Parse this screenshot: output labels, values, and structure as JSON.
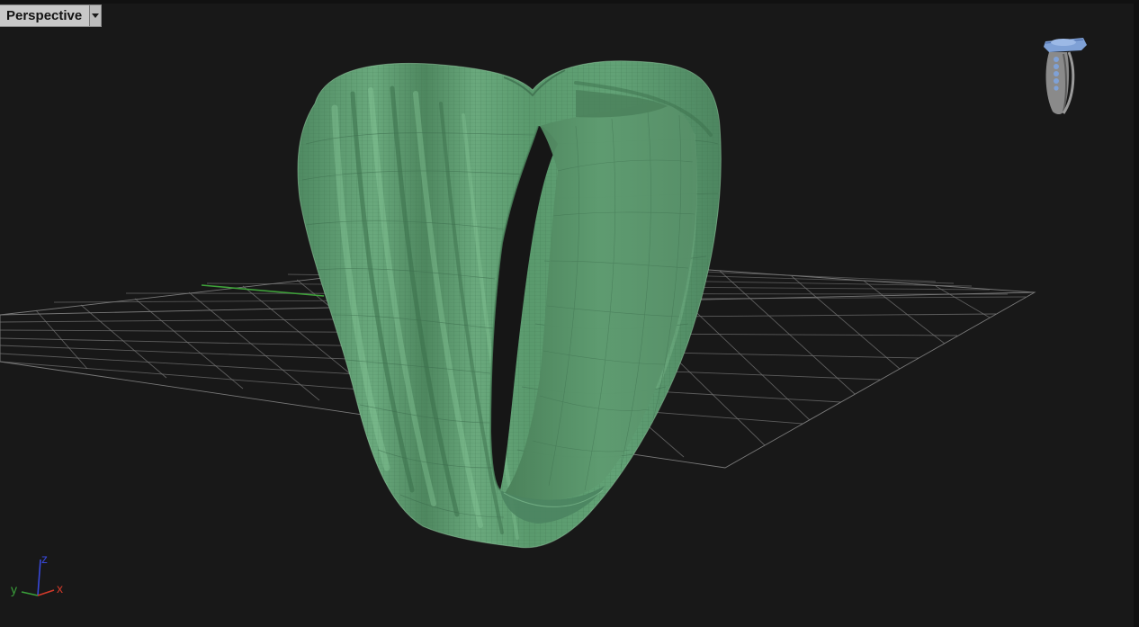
{
  "viewport": {
    "label": "Perspective",
    "dropdown_icon": "triangle-down-icon",
    "background_color": "#181818"
  },
  "scene": {
    "object": "ring",
    "display_mode": "wireframe-shaded",
    "object_color": "#5f9c72",
    "wire_color": "#3d6e4e",
    "grid_color": "#8c8c8c",
    "x_axis_color": "#c83a2e",
    "y_axis_color": "#3fa23a"
  },
  "navigation_thumbnail": {
    "icon": "ring-thumbnail-icon"
  },
  "axis_widget": {
    "x_label": "x",
    "y_label": "y",
    "z_label": "z",
    "x_color": "#d23a2a",
    "y_color": "#3aa03a",
    "z_color": "#3848d8"
  }
}
